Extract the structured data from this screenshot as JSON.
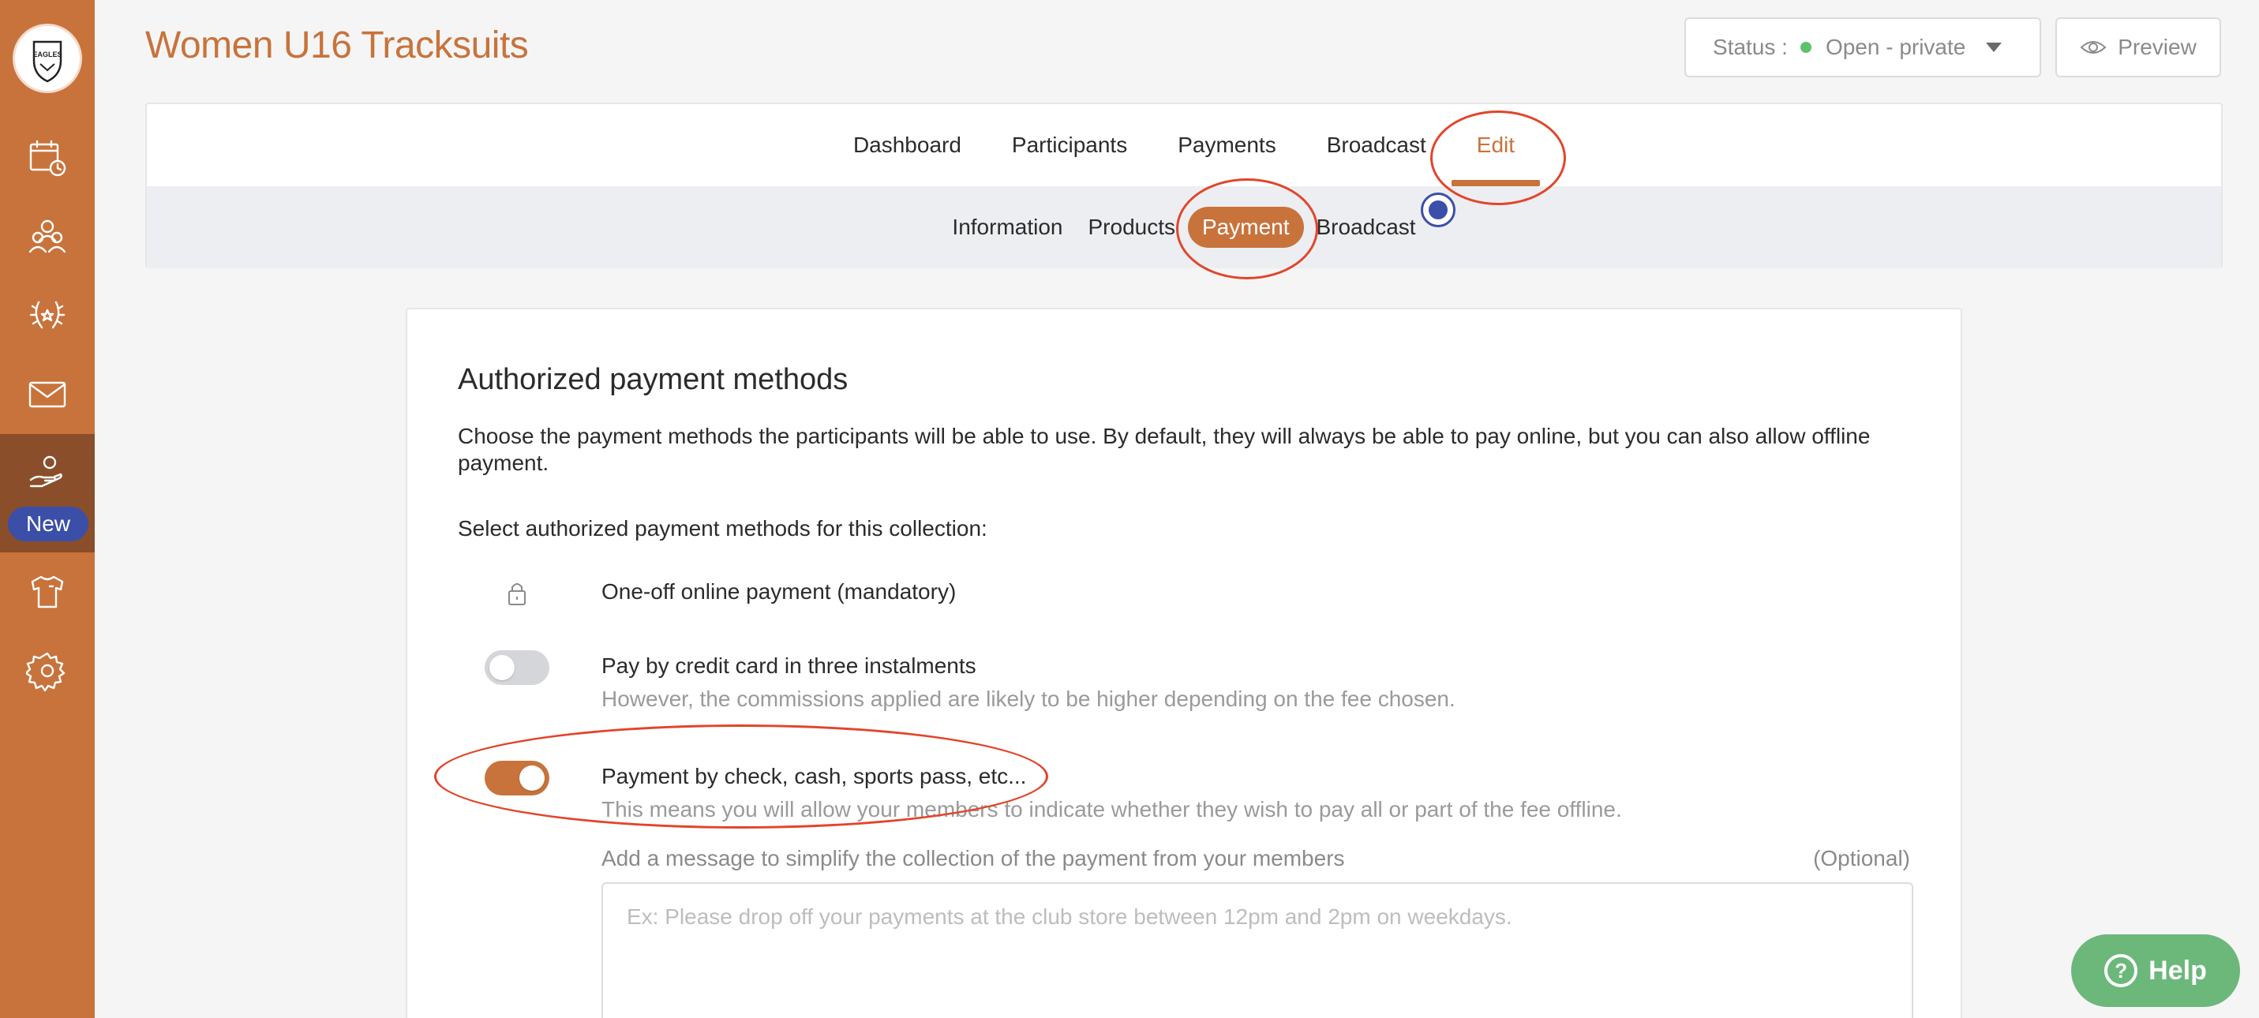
{
  "sidebar": {
    "logo_text": "EAGLES",
    "items": [
      {
        "name": "calendar",
        "icon": "calendar-clock-icon"
      },
      {
        "name": "members",
        "icon": "people-icon"
      },
      {
        "name": "competitions",
        "icon": "laurel-icon"
      },
      {
        "name": "messages",
        "icon": "envelope-icon"
      },
      {
        "name": "payments",
        "icon": "hand-coin-icon",
        "badge": "New"
      },
      {
        "name": "shop",
        "icon": "tshirt-icon"
      },
      {
        "name": "settings",
        "icon": "gear-icon"
      }
    ]
  },
  "header": {
    "title": "Women U16 Tracksuits",
    "status_label": "Status :",
    "status_value": "Open - private",
    "preview_label": "Preview"
  },
  "tabs": {
    "main": [
      "Dashboard",
      "Participants",
      "Payments",
      "Broadcast",
      "Edit"
    ],
    "active_main": "Edit",
    "sub": [
      "Information",
      "Products",
      "Payment",
      "Broadcast"
    ],
    "active_sub": "Payment"
  },
  "card": {
    "heading": "Authorized payment methods",
    "intro": "Choose the payment methods the participants will be able to use. By default, they will always be able to pay online, but you can also allow offline payment.",
    "select_label": "Select authorized payment methods for this collection:",
    "methods": [
      {
        "title": "One-off online payment (mandatory)",
        "desc": "",
        "control": "lock"
      },
      {
        "title": "Pay by credit card in three instalments",
        "desc": "However, the commissions applied are likely to be higher depending on the fee chosen.",
        "control": "toggle",
        "enabled": false
      },
      {
        "title": "Payment by check, cash, sports pass, etc...",
        "desc": "This means you will allow your members to indicate whether they wish to pay all or part of the fee offline.",
        "control": "toggle",
        "enabled": true
      }
    ],
    "message_label": "Add a message to simplify the collection of the payment from your members",
    "message_optional": "(Optional)",
    "message_placeholder": "Ex: Please drop off your payments at the club store between 12pm and 2pm on weekdays.",
    "message_value": ""
  },
  "help": {
    "label": "Help"
  },
  "colors": {
    "brand": "#c8733c",
    "sidebar_active": "#8a4e2a",
    "badge": "#3b4fa8",
    "help": "#6bb87a",
    "annotation": "#e2452b",
    "status_dot": "#5cc26b"
  }
}
